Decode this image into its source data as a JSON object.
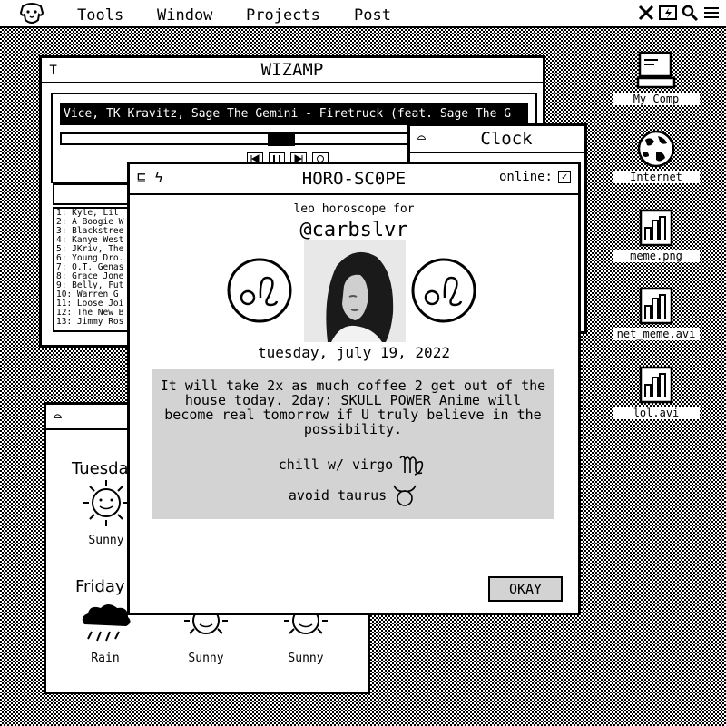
{
  "menubar": {
    "items": [
      "Tools",
      "Window",
      "Projects",
      "Post"
    ]
  },
  "wizamp": {
    "title": "WIZAMP",
    "now_playing": "Vice, TK Kravitz, Sage The Gemini - Firetruck (feat. Sage The G",
    "seek_progress": 0.47,
    "playlist": [
      "1: Kyle, Lil",
      "2: A Boogie W",
      "3: Blackstree",
      "4: Kanye West",
      "5: JKriv, The",
      "6: Young Dro.",
      "7: O.T. Genas",
      "8: Grace Jone",
      "9: Belly, Fut",
      "10: Warren G",
      "11: Loose Joi",
      "12: The New B",
      "13: Jimmy Ros"
    ]
  },
  "clock": {
    "title": "Clock"
  },
  "weather": {
    "days": [
      "Tuesda",
      "Friday"
    ],
    "conditions": [
      "Sunny",
      "Rain",
      "Sunny",
      "Sunny"
    ]
  },
  "horoscope": {
    "title": "HORO-SC0PE",
    "online_label": "online:",
    "online_checked": true,
    "subhead": "leo horoscope for",
    "handle": "@carbslvr",
    "date": "tuesday, july 19, 2022",
    "fortune": "It will take 2x as much coffee 2 get out of the house today. 2day: SKULL POWER Anime will become real tomorrow if U truly believe in the possibility.",
    "chill": "chill w/ virgo",
    "avoid": "avoid taurus",
    "okay_label": "OKAY"
  },
  "desktop_icons": [
    {
      "label": "My Comp",
      "icon": "computer-icon"
    },
    {
      "label": "Internet",
      "icon": "globe-icon"
    },
    {
      "label": "meme.png",
      "icon": "file-icon"
    },
    {
      "label": "net_meme.avi",
      "icon": "file-icon"
    },
    {
      "label": "lol.avi",
      "icon": "file-icon"
    }
  ]
}
